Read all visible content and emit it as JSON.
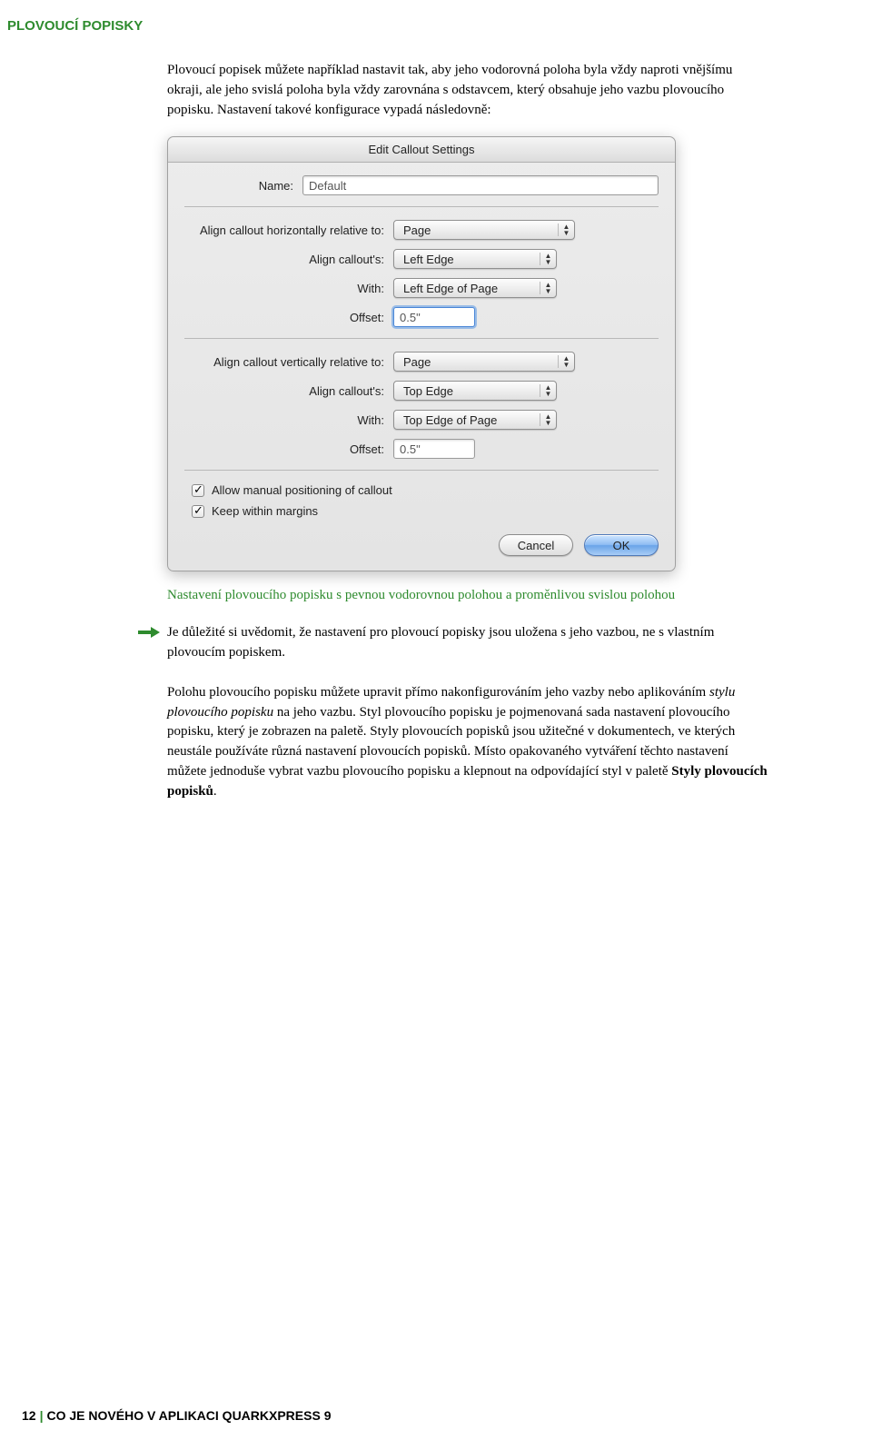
{
  "section_header": "PLOVOUCÍ POPISKY",
  "para1": "Plovoucí popisek můžete například nastavit tak, aby jeho vodorovná poloha byla vždy naproti vnějšímu okraji, ale jeho svislá poloha byla vždy zarovnána s odstavcem, který obsahuje jeho vazbu plovoucího popisku. Nastavení takové konfigurace vypadá následovně:",
  "dialog": {
    "title": "Edit Callout Settings",
    "name_label": "Name:",
    "name_value": "Default",
    "h_relative_label": "Align callout horizontally relative to:",
    "h_relative_value": "Page",
    "h_align_label": "Align callout's:",
    "h_align_value": "Left Edge",
    "h_with_label": "With:",
    "h_with_value": "Left Edge of Page",
    "h_offset_label": "Offset:",
    "h_offset_value": "0.5\"",
    "v_relative_label": "Align callout vertically relative to:",
    "v_relative_value": "Page",
    "v_align_label": "Align callout's:",
    "v_align_value": "Top Edge",
    "v_with_label": "With:",
    "v_with_value": "Top Edge of Page",
    "v_offset_label": "Offset:",
    "v_offset_value": "0.5\"",
    "chk1": "Allow manual positioning of callout",
    "chk2": "Keep within margins",
    "cancel": "Cancel",
    "ok": "OK"
  },
  "caption": "Nastavení plovoucího popisku s pevnou vodorovnou polohou a proměnlivou svislou polohou",
  "note": "Je důležité si uvědomit, že nastavení pro plovoucí popisky jsou uložena s jeho vazbou, ne s vlastním plovoucím popiskem.",
  "para2_a": "Polohu plovoucího popisku můžete upravit přímo nakonfigurováním jeho vazby nebo aplikováním ",
  "para2_ital": "stylu plovoucího popisku",
  "para2_b": " na jeho vazbu. Styl plovoucího popisku je pojmenovaná sada nastavení plovoucího popisku, který je zobrazen na paletě. Styly plovoucích popisků jsou užitečné v dokumentech, ve kterých neustále používáte různá nastavení plovoucích popisků. Místo opakovaného vytváření těchto nastavení můžete jednoduše vybrat vazbu plovoucího popisku a klepnout na odpovídající styl v paletě ",
  "para2_bold": "Styly plovoucích popisků",
  "para2_c": ".",
  "footer": {
    "page": "12",
    "title": "CO JE NOVÉHO V APLIKACI QUARKXPRESS 9"
  }
}
